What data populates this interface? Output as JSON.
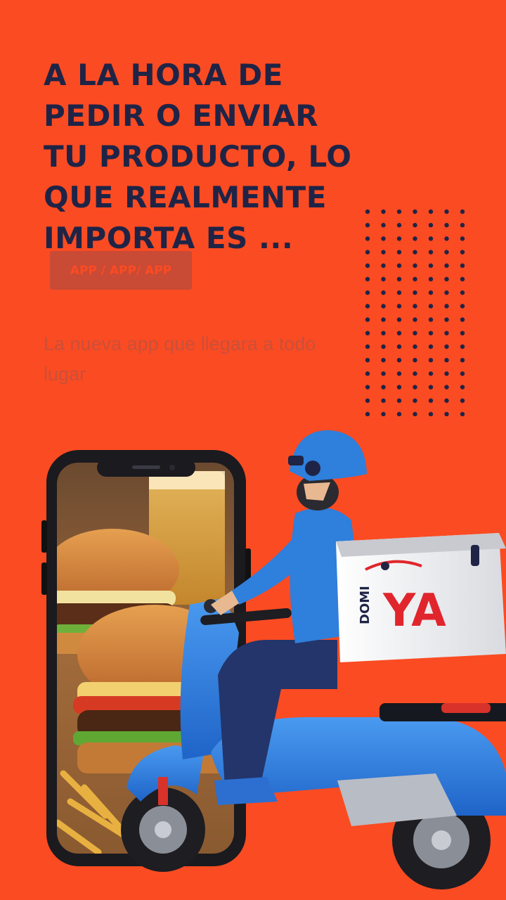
{
  "headline": {
    "lines": [
      "A LA HORA DE",
      "PEDIR O ENVIAR",
      "TU PRODUCTO, LO",
      "QUE REALMENTE",
      "IMPORTA ES ..."
    ]
  },
  "badge": {
    "label": "APP / APP/ APP"
  },
  "subtitle": "La nueva app que llegara a todo lugar",
  "box_logo": {
    "top": "DOMI",
    "main": "YA"
  },
  "colors": {
    "background": "#fb4b22",
    "headline": "#1f2446",
    "badge_bg": "#c94a35",
    "scooter_blue": "#2f7fdc",
    "logo_red": "#e0262c",
    "logo_navy": "#1f2446"
  },
  "icons": [
    "dot-grid-icon",
    "phone-mockup",
    "delivery-rider-illustration"
  ]
}
